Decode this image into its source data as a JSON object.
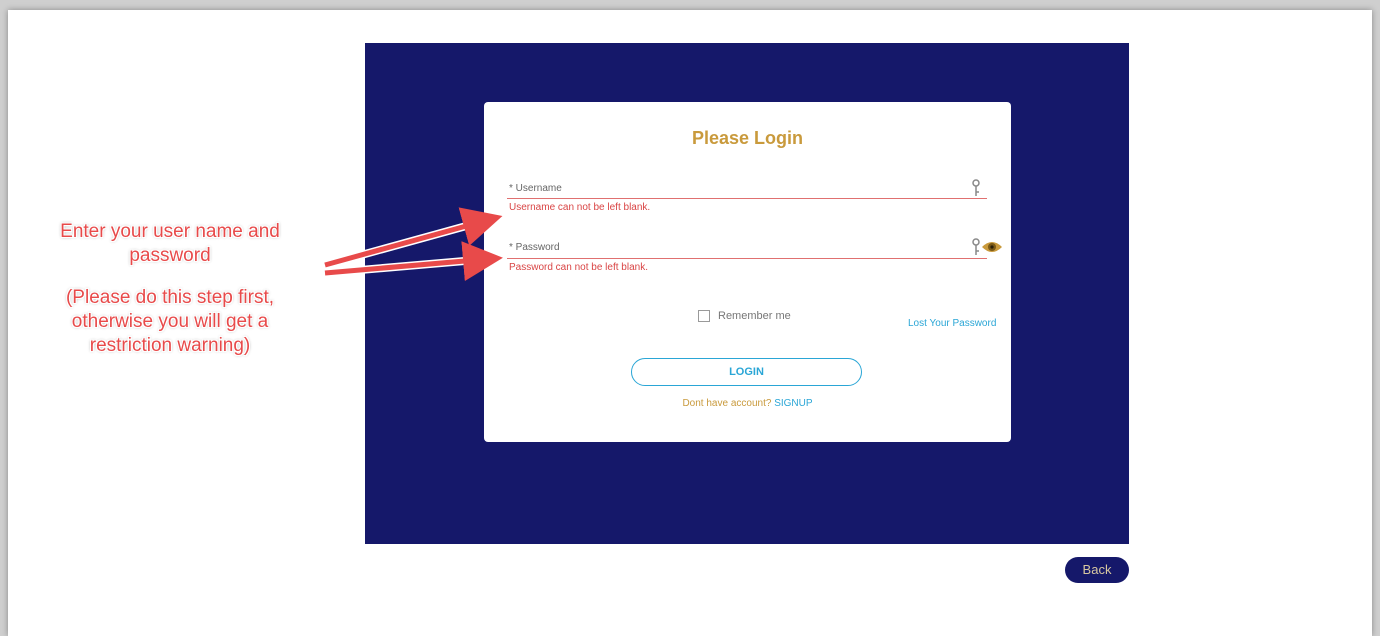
{
  "login": {
    "title": "Please Login",
    "username_label": "* Username",
    "username_error": "Username can not be left blank.",
    "password_label": "* Password",
    "password_error": "Password can not be left blank.",
    "remember_label": "Remember me",
    "lost_password": "Lost Your Password",
    "login_button": "LOGIN",
    "signup_prompt": "Dont have account?",
    "signup_link": "SIGNUP"
  },
  "back_button": "Back",
  "annotation": {
    "line1": "Enter your user name and password",
    "line2": "(Please do this step first, otherwise you will get a restriction warning)"
  },
  "icons": {
    "username": "key-icon",
    "password": "key-icon",
    "password_toggle": "eye-icon"
  },
  "colors": {
    "stage_bg": "#15186a",
    "title": "#c99a3c",
    "error": "#d94545",
    "link": "#2aa6d6",
    "annotation": "#e84a4a"
  }
}
